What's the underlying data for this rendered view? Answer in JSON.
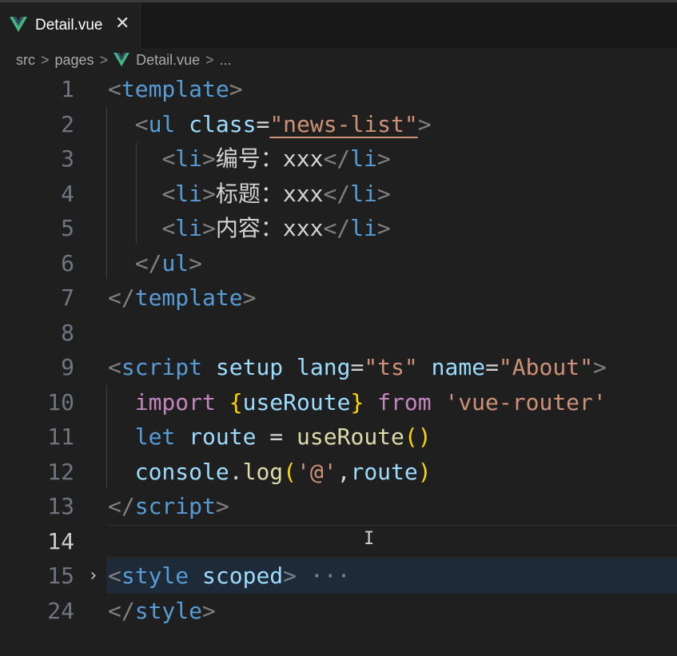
{
  "tab": {
    "label": "Detail.vue",
    "close": "✕"
  },
  "breadcrumb": {
    "items": [
      "src",
      "pages",
      "Detail.vue",
      "..."
    ],
    "separator": ">"
  },
  "editor": {
    "active_line": "14",
    "lines": [
      {
        "num": "1",
        "tokens": [
          [
            "<",
            "tag"
          ],
          [
            "template",
            "name"
          ],
          [
            ">",
            "tag"
          ]
        ]
      },
      {
        "num": "2",
        "tokens": [
          [
            "  ",
            "text"
          ],
          [
            "<",
            "tag"
          ],
          [
            "ul",
            "name"
          ],
          [
            " ",
            "text"
          ],
          [
            "class",
            "attr"
          ],
          [
            "=",
            "text"
          ],
          [
            "\"news-list\"",
            "str u"
          ],
          [
            ">",
            "tag"
          ]
        ]
      },
      {
        "num": "3",
        "tokens": [
          [
            "    ",
            "text"
          ],
          [
            "<",
            "tag"
          ],
          [
            "li",
            "name"
          ],
          [
            ">",
            "tag"
          ],
          [
            "编号：xxx",
            "text"
          ],
          [
            "</",
            "tag"
          ],
          [
            "li",
            "name"
          ],
          [
            ">",
            "tag"
          ]
        ]
      },
      {
        "num": "4",
        "tokens": [
          [
            "    ",
            "text"
          ],
          [
            "<",
            "tag"
          ],
          [
            "li",
            "name"
          ],
          [
            ">",
            "tag"
          ],
          [
            "标题：xxx",
            "text"
          ],
          [
            "</",
            "tag"
          ],
          [
            "li",
            "name"
          ],
          [
            ">",
            "tag"
          ]
        ]
      },
      {
        "num": "5",
        "tokens": [
          [
            "    ",
            "text"
          ],
          [
            "<",
            "tag"
          ],
          [
            "li",
            "name"
          ],
          [
            ">",
            "tag"
          ],
          [
            "内容：xxx",
            "text"
          ],
          [
            "</",
            "tag"
          ],
          [
            "li",
            "name"
          ],
          [
            ">",
            "tag"
          ]
        ]
      },
      {
        "num": "6",
        "tokens": [
          [
            "  ",
            "text"
          ],
          [
            "</",
            "tag"
          ],
          [
            "ul",
            "name"
          ],
          [
            ">",
            "tag"
          ]
        ]
      },
      {
        "num": "7",
        "tokens": [
          [
            "</",
            "tag"
          ],
          [
            "template",
            "name"
          ],
          [
            ">",
            "tag"
          ]
        ]
      },
      {
        "num": "8",
        "tokens": []
      },
      {
        "num": "9",
        "tokens": [
          [
            "<",
            "tag"
          ],
          [
            "script",
            "name"
          ],
          [
            " ",
            "text"
          ],
          [
            "setup",
            "attr"
          ],
          [
            " ",
            "text"
          ],
          [
            "lang",
            "attr"
          ],
          [
            "=",
            "text"
          ],
          [
            "\"ts\"",
            "str"
          ],
          [
            " ",
            "text"
          ],
          [
            "name",
            "attr"
          ],
          [
            "=",
            "text"
          ],
          [
            "\"About\"",
            "str"
          ],
          [
            ">",
            "tag"
          ]
        ]
      },
      {
        "num": "10",
        "tokens": [
          [
            "  ",
            "text"
          ],
          [
            "import",
            "kw"
          ],
          [
            " ",
            "text"
          ],
          [
            "{",
            "br1"
          ],
          [
            "useRoute",
            "var"
          ],
          [
            "}",
            "br1"
          ],
          [
            " ",
            "text"
          ],
          [
            "from",
            "kw"
          ],
          [
            " ",
            "text"
          ],
          [
            "'vue-router'",
            "str"
          ]
        ]
      },
      {
        "num": "11",
        "tokens": [
          [
            "  ",
            "text"
          ],
          [
            "let",
            "decl"
          ],
          [
            " ",
            "text"
          ],
          [
            "route",
            "var"
          ],
          [
            " = ",
            "text"
          ],
          [
            "useRoute",
            "fn"
          ],
          [
            "()",
            "br1"
          ]
        ]
      },
      {
        "num": "12",
        "tokens": [
          [
            "  ",
            "text"
          ],
          [
            "console",
            "var"
          ],
          [
            ".",
            "text"
          ],
          [
            "log",
            "fn"
          ],
          [
            "(",
            "br1"
          ],
          [
            "'@'",
            "str"
          ],
          [
            ",",
            "text"
          ],
          [
            "route",
            "var"
          ],
          [
            ")",
            "br1"
          ]
        ]
      },
      {
        "num": "13",
        "tokens": [
          [
            "</",
            "tag"
          ],
          [
            "script",
            "name"
          ],
          [
            ">",
            "tag"
          ]
        ]
      },
      {
        "num": "14",
        "tokens": []
      },
      {
        "num": "15",
        "tokens": [
          [
            "<",
            "tag"
          ],
          [
            "style",
            "name"
          ],
          [
            " ",
            "text"
          ],
          [
            "scoped",
            "attr"
          ],
          [
            ">",
            "tag"
          ],
          [
            " ···",
            "dots"
          ]
        ],
        "folded": true
      },
      {
        "num": "24",
        "tokens": [
          [
            "</",
            "tag"
          ],
          [
            "style",
            "name"
          ],
          [
            ">",
            "tag"
          ]
        ]
      }
    ]
  },
  "icons": {
    "tab": "vue-logo-icon",
    "breadcrumb": "vue-logo-icon",
    "fold": "chevron-right-icon",
    "cursor": "text-cursor-icon"
  },
  "colors": {
    "background": "#1f1f1f",
    "tag": "#808080",
    "element": "#569cd6",
    "attribute": "#9cdcfe",
    "string": "#ce9178",
    "keyword": "#c586c0",
    "function": "#dcdcaa",
    "bracket": "#ffd700",
    "vue_green": "#41b883"
  }
}
